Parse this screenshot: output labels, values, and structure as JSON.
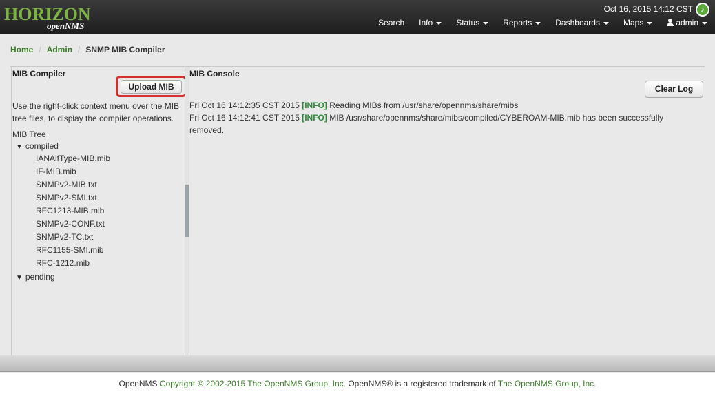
{
  "header": {
    "logo_main": "HORIZON",
    "logo_sub": "openNMS",
    "datetime": "Oct 16, 2015 14:12 CST",
    "nav": [
      {
        "label": "Search",
        "dropdown": false
      },
      {
        "label": "Info",
        "dropdown": true
      },
      {
        "label": "Status",
        "dropdown": true
      },
      {
        "label": "Reports",
        "dropdown": true
      },
      {
        "label": "Dashboards",
        "dropdown": true
      },
      {
        "label": "Maps",
        "dropdown": true
      },
      {
        "label": "admin",
        "dropdown": true
      }
    ]
  },
  "breadcrumb": {
    "home": "Home",
    "admin": "Admin",
    "current": "SNMP MIB Compiler"
  },
  "left_panel": {
    "title": "MIB Compiler",
    "upload_label": "Upload MIB",
    "description": "Use the right-click context menu over the MIB tree files, to display the compiler operations.",
    "tree_title": "MIB Tree",
    "compiled_label": "compiled",
    "compiled_files": [
      "IANAifType-MIB.mib",
      "IF-MIB.mib",
      "SNMPv2-MIB.txt",
      "SNMPv2-SMI.txt",
      "RFC1213-MIB.mib",
      "SNMPv2-CONF.txt",
      "SNMPv2-TC.txt",
      "RFC1155-SMI.mib",
      "RFC-1212.mib"
    ],
    "pending_label": "pending"
  },
  "right_panel": {
    "title": "MIB Console",
    "clear_label": "Clear Log",
    "log": [
      {
        "time": "Fri Oct 16 14:12:35 CST 2015",
        "level": "[INFO]",
        "message": "Reading MIBs from /usr/share/opennms/share/mibs"
      },
      {
        "time": "Fri Oct 16 14:12:41 CST 2015",
        "level": "[INFO]",
        "message": "MIB /usr/share/opennms/share/mibs/compiled/CYBEROAM-MIB.mib has been successfully removed."
      }
    ]
  },
  "footer": {
    "part1": "OpenNMS",
    "part2": " Copyright © 2002-2015 ",
    "part3": "The OpenNMS Group, Inc.",
    "part4": " OpenNMS® is a registered trademark of ",
    "part5": "The OpenNMS Group, Inc."
  },
  "colors": {
    "accent_green": "#3c7a2a",
    "info_green": "#2e8b3a",
    "highlight_red": "#d32f2f"
  }
}
